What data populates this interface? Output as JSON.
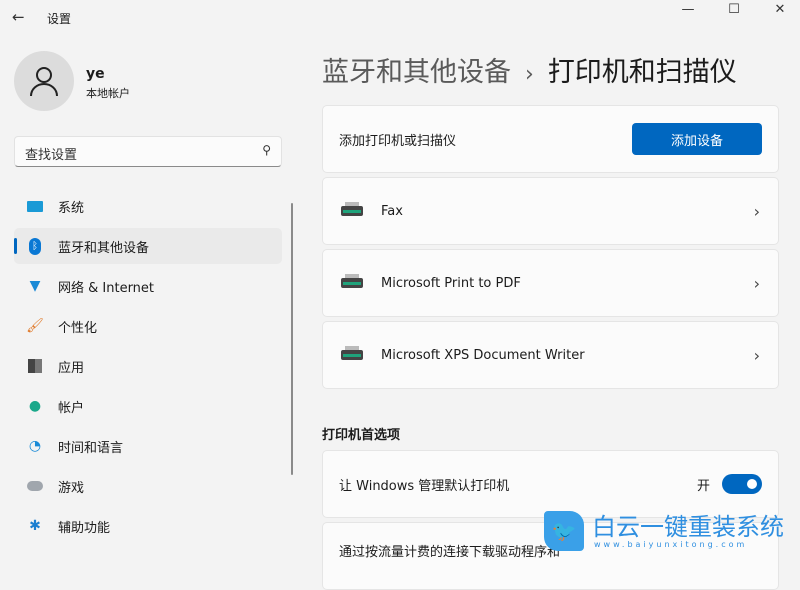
{
  "window": {
    "title": "设置",
    "back_icon": "arrow-left-icon",
    "min_icon": "minimize-icon",
    "max_icon": "maximize-icon",
    "close_icon": "close-icon"
  },
  "user": {
    "name": "ye",
    "account_type": "本地帐户"
  },
  "search": {
    "placeholder": "查找设置"
  },
  "sidebar": {
    "items": [
      {
        "label": "系统",
        "icon": "monitor-icon"
      },
      {
        "label": "蓝牙和其他设备",
        "icon": "bluetooth-icon",
        "active": true
      },
      {
        "label": "网络 & Internet",
        "icon": "wifi-icon"
      },
      {
        "label": "个性化",
        "icon": "brush-icon"
      },
      {
        "label": "应用",
        "icon": "apps-icon"
      },
      {
        "label": "帐户",
        "icon": "person-icon"
      },
      {
        "label": "时间和语言",
        "icon": "clock-globe-icon"
      },
      {
        "label": "游戏",
        "icon": "gamepad-icon"
      },
      {
        "label": "辅助功能",
        "icon": "accessibility-icon"
      }
    ]
  },
  "breadcrumb": {
    "parent": "蓝牙和其他设备",
    "separator": "›",
    "current": "打印机和扫描仪"
  },
  "add_card": {
    "label": "添加打印机或扫描仪",
    "button": "添加设备"
  },
  "printers": [
    {
      "name": "Fax"
    },
    {
      "name": "Microsoft Print to PDF"
    },
    {
      "name": "Microsoft XPS Document Writer"
    }
  ],
  "preferences": {
    "title": "打印机首选项",
    "default_printer": {
      "label": "让 Windows 管理默认打印机",
      "state": "开",
      "on": true
    },
    "metered": {
      "label": "通过按流量计费的连接下载驱动程序和"
    }
  },
  "watermark": {
    "title": "白云一键重装系统",
    "url": "www.baiyunxitong.com"
  },
  "colors": {
    "accent": "#0067c0",
    "background": "#f3f3f3"
  }
}
